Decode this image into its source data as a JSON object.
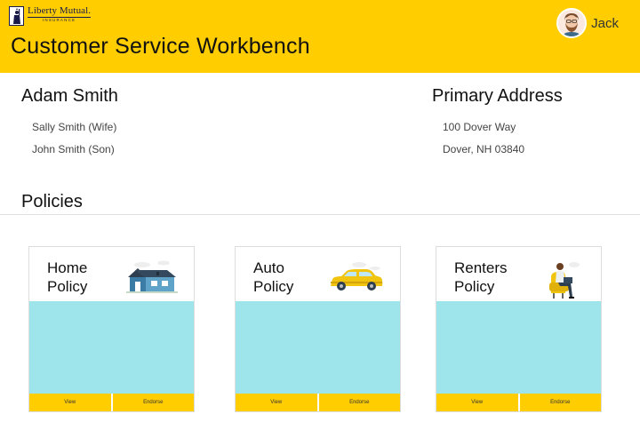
{
  "header": {
    "logo_name": "Liberty Mutual.",
    "logo_sub": "INSURANCE",
    "title": "Customer Service Workbench",
    "user_name": "Jack"
  },
  "customer": {
    "name": "Adam Smith",
    "family": [
      "Sally Smith (Wife)",
      "John Smith (Son)"
    ]
  },
  "address": {
    "title": "Primary Address",
    "line1": "100 Dover Way",
    "line2": "Dover, NH 03840"
  },
  "policies": {
    "title": "Policies",
    "cards": [
      {
        "title_line1": "Home",
        "title_line2": "Policy",
        "illustration": "house-icon",
        "view_label": "View",
        "endorse_label": "Endorse"
      },
      {
        "title_line1": "Auto",
        "title_line2": "Policy",
        "illustration": "car-icon",
        "view_label": "View",
        "endorse_label": "Endorse"
      },
      {
        "title_line1": "Renters",
        "title_line2": "Policy",
        "illustration": "person-in-chair-icon",
        "view_label": "View",
        "endorse_label": "Endorse"
      }
    ]
  },
  "colors": {
    "brand_yellow": "#ffcd00",
    "card_body": "#9de5ea",
    "accent_blue": "#2f6e8f"
  }
}
